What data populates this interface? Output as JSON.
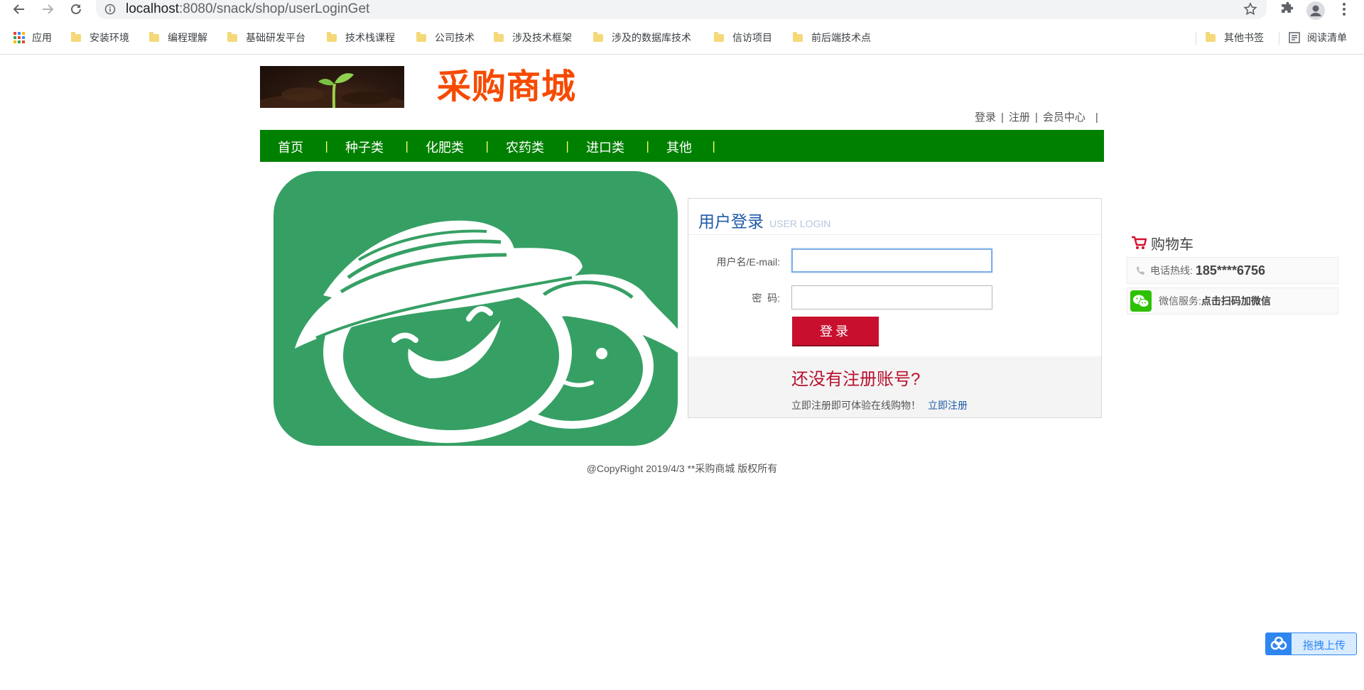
{
  "browser": {
    "url_host": "localhost",
    "url_path": ":8080/snack/shop/userLoginGet",
    "bookmarks": [
      {
        "label": "应用"
      },
      {
        "label": "安装环境"
      },
      {
        "label": "编程理解"
      },
      {
        "label": "基础研发平台"
      },
      {
        "label": "技术栈课程"
      },
      {
        "label": "公司技术"
      },
      {
        "label": "涉及技术框架"
      },
      {
        "label": "涉及的数据库技术"
      },
      {
        "label": "信访项目"
      },
      {
        "label": "前后端技术点"
      }
    ],
    "other_bookmarks": "其他书签",
    "reading_list": "阅读清单"
  },
  "header": {
    "site_title": "采购商城",
    "user_links": [
      "登录",
      "注册",
      "会员中心"
    ],
    "separator": "|"
  },
  "nav": {
    "items": [
      "首页",
      "种子类",
      "化肥类",
      "农药类",
      "进口类",
      "其他"
    ],
    "separator": "|"
  },
  "login": {
    "title": "用户登录",
    "title_en": "USER LOGIN",
    "username_label": "用户名/E-mail:",
    "username_value": "",
    "password_label": "密  码:",
    "password_value": "",
    "submit_label": "登录",
    "register_prompt": "还没有注册账号?",
    "register_text": "立即注册即可体验在线购物！",
    "register_link": "立即注册"
  },
  "side": {
    "cart_label": "购物车",
    "hotline_label": "电话热线:",
    "hotline_value": "185****6756",
    "wechat_label": "微信服务:",
    "wechat_value": "点击扫码加微信"
  },
  "footer": {
    "copyright": "@CopyRight 2019/4/3 **采购商城 版权所有"
  },
  "upload": {
    "label": "拖拽上传"
  },
  "colors": {
    "brand_orange": "#f64a00",
    "nav_green": "#008000",
    "login_red": "#c8102e",
    "link_blue": "#1e5aa8",
    "hero_green": "#36a064"
  }
}
